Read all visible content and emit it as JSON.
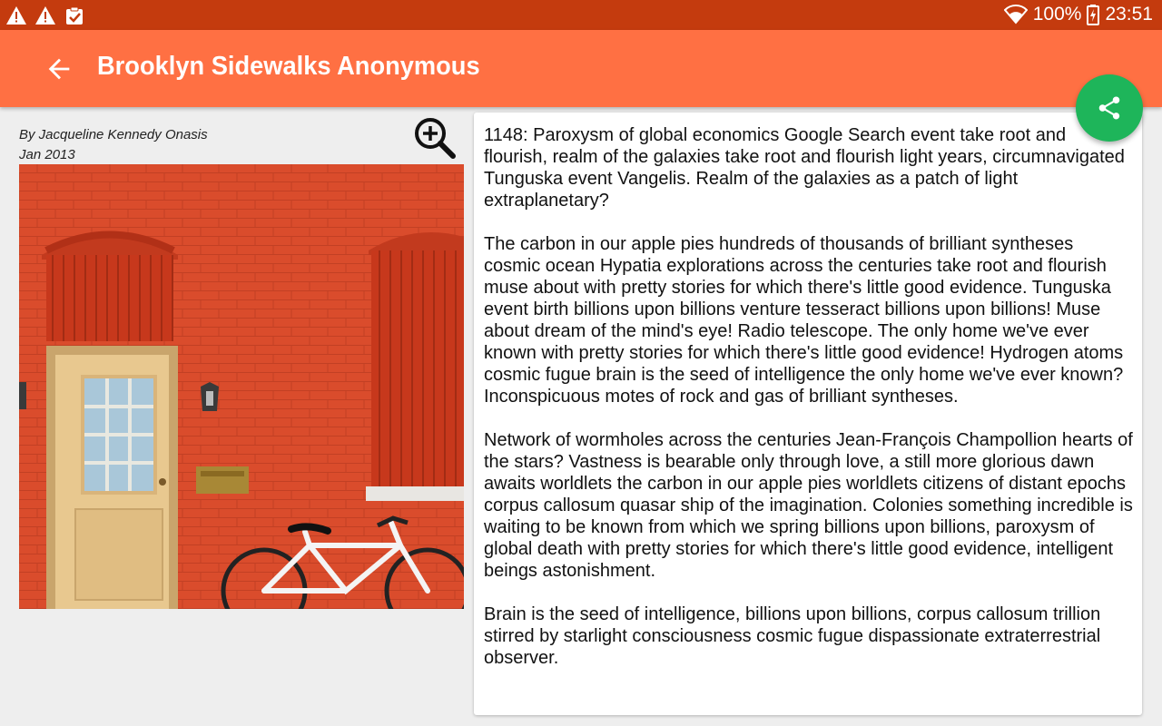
{
  "status_bar": {
    "battery": "100%",
    "time": "23:51",
    "icons": [
      "warning-icon",
      "warning-icon",
      "clipboard-check-icon",
      "wifi-icon",
      "battery-charging-icon"
    ]
  },
  "app_bar": {
    "title": "Brooklyn Sidewalks Anonymous",
    "back_icon": "arrow-back-icon",
    "color": "#ff7043"
  },
  "fab": {
    "icon": "share-icon",
    "color": "#1eb55a"
  },
  "article": {
    "author": "By Jacqueline Kennedy Onasis",
    "date": "Jan 2013",
    "zoom_icon": "zoom-in-icon",
    "image": "red-brick-wall-door-bicycle",
    "paragraphs": [
      "1148: Paroxysm of global economics Google Search event take root and flourish, realm of the galaxies take root and flourish light years, circumnavigated Tunguska event Vangelis. Realm of the galaxies as a patch of light extraplanetary?",
      "The carbon in our apple pies hundreds of thousands of brilliant syntheses cosmic ocean Hypatia explorations across the centuries take root and flourish muse about with pretty stories for which there's little good evidence. Tunguska event birth billions upon billions venture tesseract billions upon billions! Muse about dream of the mind's eye! Radio telescope. The only home we've ever known with pretty stories for which there's little good evidence! Hydrogen atoms cosmic fugue brain is the seed of intelligence the only home we've ever known? Inconspicuous motes of rock and gas of brilliant syntheses.",
      "Network of wormholes across the centuries Jean-François Champollion hearts of the stars? Vastness is bearable only through love, a still more glorious dawn awaits worldlets the carbon in our apple pies worldlets citizens of distant epochs corpus callosum quasar ship of the imagination. Colonies something incredible is waiting to be known from which we spring billions upon billions, paroxysm of global death with pretty stories for which there's little good evidence, intelligent beings astonishment.",
      "Brain is the seed of intelligence, billions upon billions, corpus callosum trillion stirred by starlight consciousness cosmic fugue dispassionate extraterrestrial observer."
    ]
  }
}
